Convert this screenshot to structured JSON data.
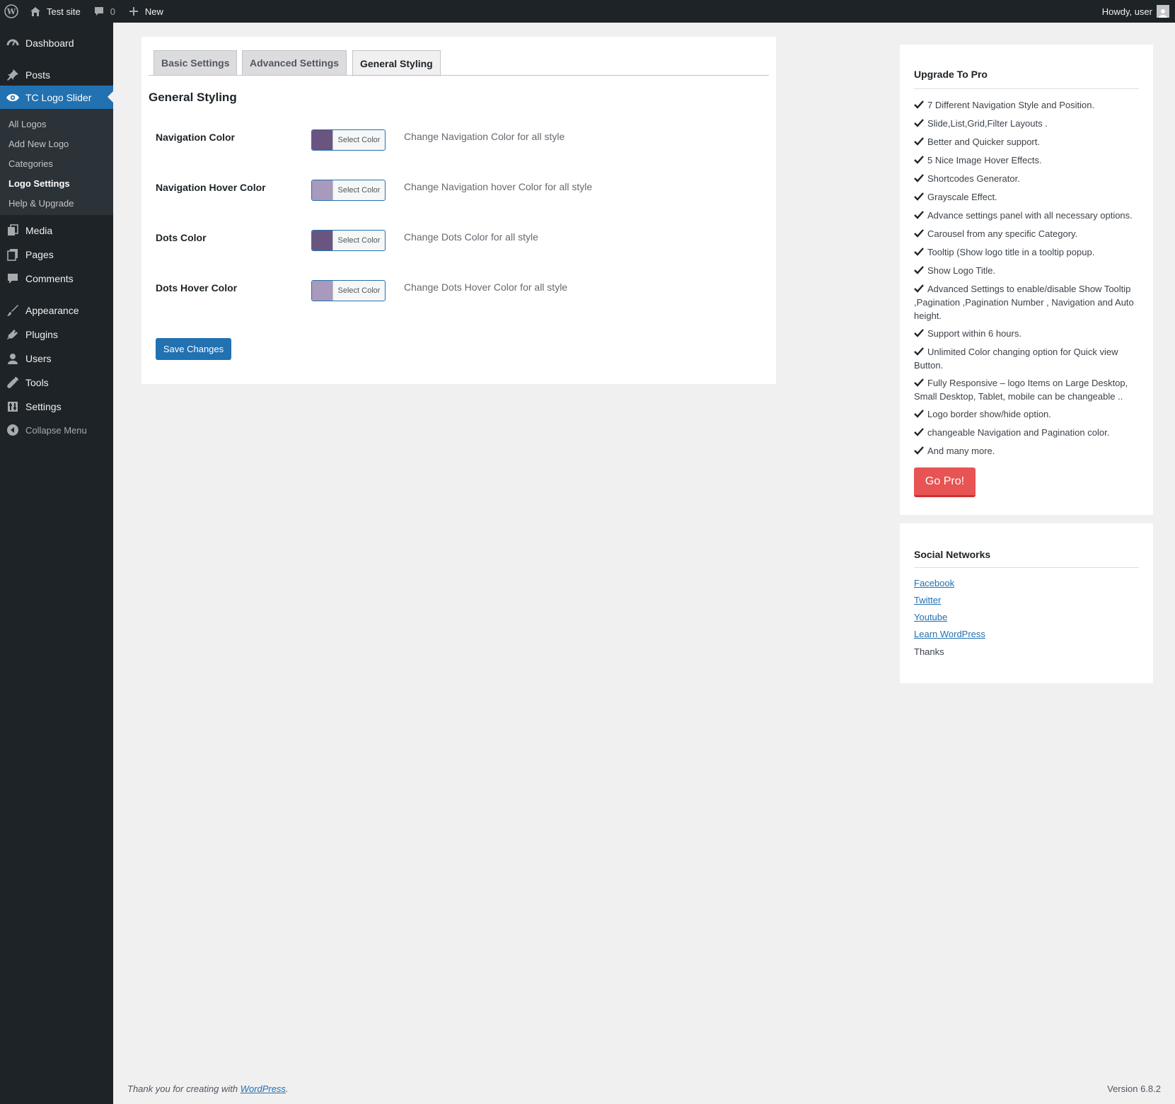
{
  "admin_bar": {
    "site_name": "Test site",
    "comments_count": "0",
    "new_label": "New",
    "howdy": "Howdy, user"
  },
  "sidebar": {
    "items": [
      {
        "label": "Dashboard",
        "icon": "dashboard-icon"
      },
      {
        "label": "Posts",
        "icon": "pin-icon"
      },
      {
        "label": "TC Logo Slider",
        "icon": "eye-icon"
      },
      {
        "label": "Media",
        "icon": "media-icon"
      },
      {
        "label": "Pages",
        "icon": "pages-icon"
      },
      {
        "label": "Comments",
        "icon": "comment-icon"
      },
      {
        "label": "Appearance",
        "icon": "brush-icon"
      },
      {
        "label": "Plugins",
        "icon": "plug-icon"
      },
      {
        "label": "Users",
        "icon": "user-icon"
      },
      {
        "label": "Tools",
        "icon": "wrench-icon"
      },
      {
        "label": "Settings",
        "icon": "sliders-icon"
      }
    ],
    "submenu": [
      "All Logos",
      "Add New Logo",
      "Categories",
      "Logo Settings",
      "Help & Upgrade"
    ],
    "collapse_label": "Collapse Menu"
  },
  "tabs": [
    "Basic Settings",
    "Advanced Settings",
    "General Styling"
  ],
  "section_title": "General Styling",
  "settings": [
    {
      "label": "Navigation Color",
      "button": "Select Color",
      "swatch": "#6a5580",
      "desc": "Change Navigation Color for all style"
    },
    {
      "label": "Navigation Hover Color",
      "button": "Select Color",
      "swatch": "#a899bd",
      "desc": "Change Navigation hover Color for all style"
    },
    {
      "label": "Dots Color",
      "button": "Select Color",
      "swatch": "#6a5580",
      "desc": "Change Dots Color for all style"
    },
    {
      "label": "Dots Hover Color",
      "button": "Select Color",
      "swatch": "#a899bd",
      "desc": "Change Dots Hover Color for all style"
    }
  ],
  "save_label": "Save Changes",
  "upgrade": {
    "title": "Upgrade To Pro",
    "features": [
      "7 Different Navigation Style and Position.",
      "Slide,List,Grid,Filter Layouts .",
      "Better and Quicker support.",
      "5 Nice Image Hover Effects.",
      "Shortcodes Generator.",
      "Grayscale Effect.",
      "Advance settings panel with all necessary options.",
      "Carousel from any specific Category.",
      "Tooltip (Show logo title in a tooltip popup.",
      "Show Logo Title.",
      "Advanced Settings to enable/disable Show Tooltip ,Pagination ,Pagination Number , Navigation and Auto height.",
      "Support within 6 hours.",
      "Unlimited Color changing option for Quick view Button.",
      "Fully Responsive – logo Items on Large Desktop, Small Desktop, Tablet, mobile can be changeable ..",
      "Logo border show/hide option.",
      "changeable Navigation and Pagination color.",
      "And many more."
    ],
    "button": "Go Pro!"
  },
  "social": {
    "title": "Social Networks",
    "links": [
      "Facebook",
      "Twitter",
      "Youtube",
      "Learn WordPress"
    ],
    "thanks": "Thanks"
  },
  "footer": {
    "prefix": "Thank you for creating with ",
    "link": "WordPress",
    "suffix": ".",
    "version": "Version 6.8.2"
  },
  "colors": {
    "admin_bg": "#1d2327",
    "accent": "#2271b1",
    "go_pro": "#e85353"
  }
}
